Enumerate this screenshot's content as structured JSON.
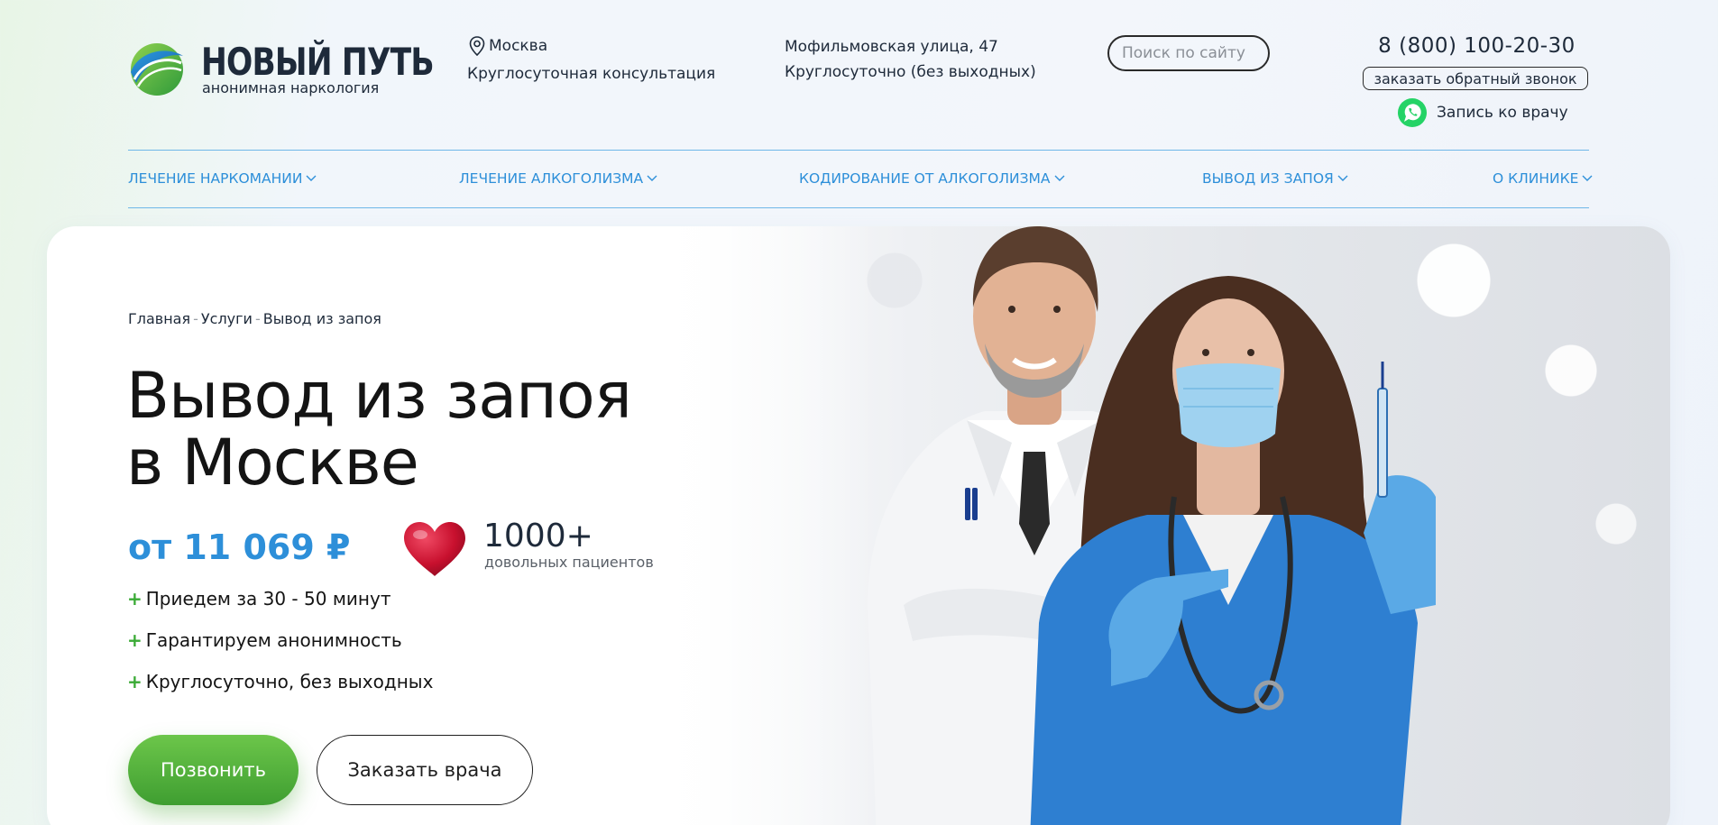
{
  "header": {
    "logo_title": "НОВЫЙ ПУТЬ",
    "logo_subtitle": "анонимная наркология",
    "city": "Москва",
    "consult": "Круглосуточная консультация",
    "address_line1": "Мофильмовская улица, 47",
    "address_line2": "Круглосуточно (без выходных)",
    "search_placeholder": "Поиск по сайту",
    "phone": "8 (800) 100-20-30",
    "callback_label": "заказать обратный звонок",
    "whatsapp_label": "Запись ко врачу"
  },
  "nav": {
    "items": [
      {
        "label": "ЛЕЧЕНИЕ НАРКОМАНИИ"
      },
      {
        "label": "ЛЕЧЕНИЕ АЛКОГОЛИЗМА"
      },
      {
        "label": "КОДИРОВАНИЕ ОТ АЛКОГОЛИЗМА"
      },
      {
        "label": "ВЫВОД ИЗ ЗАПОЯ"
      },
      {
        "label": "О КЛИНИКЕ"
      }
    ]
  },
  "hero": {
    "breadcrumbs": [
      "Главная",
      "Услуги",
      "Вывод из запоя"
    ],
    "breadcrumb_sep": "-",
    "title_line1": "Вывод из запоя",
    "title_line2": "в Москве",
    "price": "от 11 069 ₽",
    "stat_number": "1000+",
    "stat_label": "довольных пациентов",
    "features": [
      "Приедем за 30 - 50 минут",
      "Гарантируем анонимность",
      "Круглосуточно, без выходных"
    ],
    "feature_bullet": "+",
    "call_button": "Позвонить",
    "doctor_button": "Заказать врача"
  },
  "colors": {
    "accent_blue": "#2d8fd9",
    "accent_green": "#3aaa35",
    "heart_red": "#c8102e",
    "whatsapp_green": "#25d366"
  },
  "icons": {
    "city": "location-pin-icon",
    "whatsapp": "whatsapp-icon",
    "nav_dropdown": "chevron-down-icon",
    "stat": "heart-icon",
    "logo": "logo-mark-icon"
  }
}
